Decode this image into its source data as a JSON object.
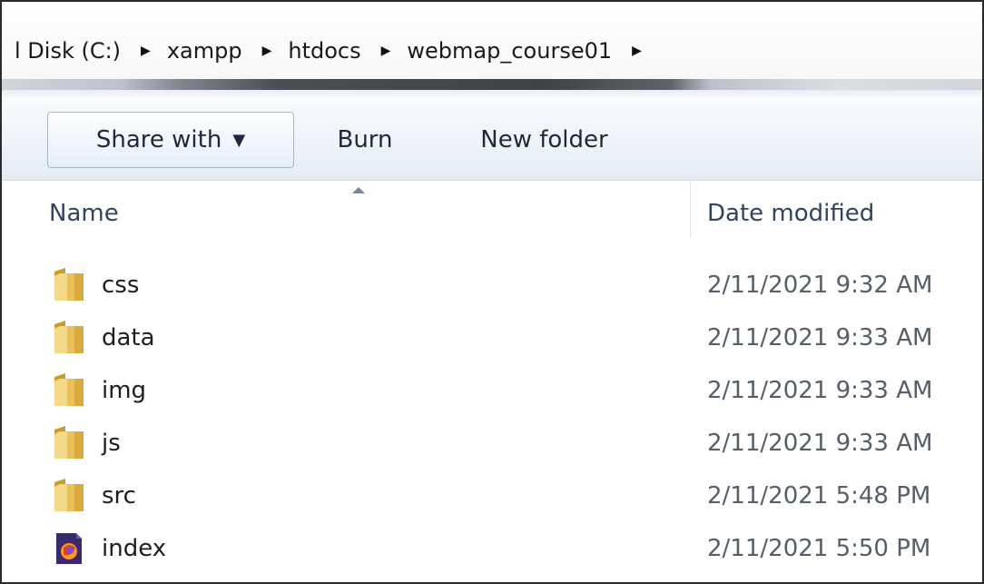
{
  "breadcrumb": {
    "items": [
      "l Disk (C:)",
      "xampp",
      "htdocs",
      "webmap_course01"
    ],
    "separator": "▶"
  },
  "toolbar": {
    "share_label": "Share with",
    "share_caret": "▼",
    "burn_label": "Burn",
    "new_folder_label": "New folder"
  },
  "columns": {
    "name": "Name",
    "date_modified": "Date modified"
  },
  "files": [
    {
      "name": "css",
      "date": "2/11/2021 9:32 AM",
      "icon": "folder-icon"
    },
    {
      "name": "data",
      "date": "2/11/2021 9:33 AM",
      "icon": "folder-icon"
    },
    {
      "name": "img",
      "date": "2/11/2021 9:33 AM",
      "icon": "folder-icon"
    },
    {
      "name": "js",
      "date": "2/11/2021 9:33 AM",
      "icon": "folder-icon"
    },
    {
      "name": "src",
      "date": "2/11/2021 5:48 PM",
      "icon": "folder-icon"
    },
    {
      "name": "index",
      "date": "2/11/2021 5:50 PM",
      "icon": "firefox-html-icon"
    }
  ],
  "colors": {
    "folder": "#e8c15a",
    "folder_dark": "#c99a2e",
    "toolbar_text": "#1e2a3a",
    "header_text": "#30445e"
  }
}
